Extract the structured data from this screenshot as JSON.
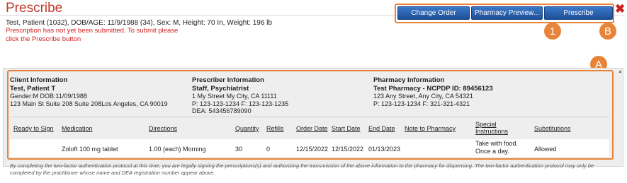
{
  "window": {
    "title": "Prescribe",
    "close_glyph": "✖"
  },
  "patient_summary": "Test, Patient (1032), DOB/AGE: 11/9/1988 (34), Sex: M, Height: 70 In, Weight: 196 lb",
  "warning_lines": [
    "Prescription has not yet been submitted. To submit please",
    "click the Prescribe button"
  ],
  "toolbar": {
    "change_order": "Change Order",
    "pharmacy_preview": "Pharmacy Preview...",
    "prescribe": "Prescribe"
  },
  "annotations": {
    "marker_1": "1",
    "marker_b": "B",
    "marker_a": "A"
  },
  "client": {
    "heading": "Client Information",
    "name": "Test, Patient T",
    "gender_dob": "Gender:M   DOB:11/09/1988",
    "address": "123 Main St Suite 208 Suite 208Los Angeles, CA 90019"
  },
  "prescriber": {
    "heading": "Prescriber Information",
    "name": "Staff, Psychiatrist",
    "address": "1 My Street My City, CA 11111",
    "phone_fax": "P: 123-123-1234   F: 123-123-1235",
    "dea": "DEA: 543456789090"
  },
  "pharmacy": {
    "heading": "Pharmacy Information",
    "name": "Test Pharmacy - NCPDP ID: 89456123",
    "address": "123 Any Street, Any City, CA 54321",
    "phone_fax": "P: 123-123-1234   F: 321-321-4321"
  },
  "table": {
    "headers": {
      "ready": "Ready to Sign",
      "medication": "Medication",
      "directions": "Directions",
      "quantity": "Quantity",
      "refills": "Refills",
      "order_date": "Order Date",
      "start_date": "Start Date",
      "end_date": "End Date",
      "note": "Note to Pharmacy",
      "special_1": "Special",
      "special_2": "Instructions",
      "substitutions": "Substitutions"
    },
    "row": {
      "ready": "",
      "medication": "Zoloft 100 mg tablet",
      "directions": "1.00 (each) Morning",
      "quantity": "30",
      "refills": "0",
      "order_date": "12/15/2022",
      "start_date": "12/15/2022",
      "end_date": "01/13/2023",
      "note": "",
      "special_1": "Take with food.",
      "special_2": "Once a day.",
      "substitutions": "Allowed"
    }
  },
  "footer_text": "By completing the two-factor authentication protocol at this time, you are legally signing the prescriptions(s) and authorizing the transmission of the above information to the pharmacy for dispensing. The two-factor authentication protocol may only be completed by the practitioner whose name and DEA registration number appear above.",
  "colors": {
    "accent": "#e8833a",
    "title": "#c0392b",
    "button": "#2b5fad",
    "warning": "#d02020"
  }
}
